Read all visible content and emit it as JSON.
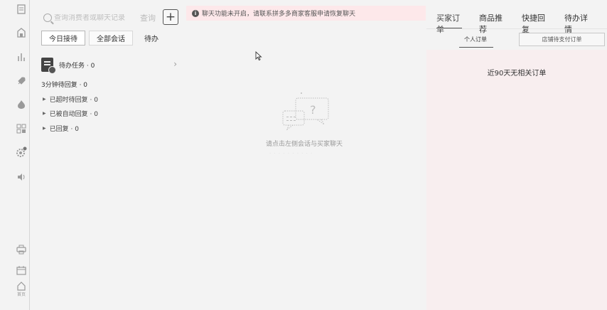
{
  "rail": {
    "icons": [
      "document-icon",
      "shop-icon",
      "bar-chart-icon",
      "rocket-icon",
      "flame-icon",
      "grid-icon",
      "gear-badge-icon",
      "speaker-icon",
      "printer-icon",
      "calendar-icon",
      "home-icon"
    ],
    "home_label": "首页"
  },
  "search": {
    "placeholder": "查询消费者或聊天记录",
    "query_label": "查询",
    "add_label": "+"
  },
  "conversation_tabs": [
    {
      "label": "今日接待",
      "active": true
    },
    {
      "label": "全部会话",
      "active": false
    },
    {
      "label": "待办",
      "active": false
    }
  ],
  "tasks": {
    "label": "待办任务 · 0",
    "arrow": "›"
  },
  "reply_section": {
    "title": "3分钟待回复 · 0",
    "items": [
      {
        "label": "已超时待回复 · 0"
      },
      {
        "label": "已被自动回复 · 0"
      },
      {
        "label": "已回复 · 0"
      }
    ]
  },
  "banner": {
    "icon": "info-icon",
    "text": "聊天功能未开启，请联系拼多多商家客服申请恢复聊天"
  },
  "empty_state": {
    "text": "请点击左侧会话与买家聊天",
    "subtext": "· · · · · · · · · ·",
    "icon": "chat-question-icon"
  },
  "right_panel": {
    "tabs": [
      {
        "label": "买家订单",
        "active": true
      },
      {
        "label": "商品推荐",
        "active": false
      },
      {
        "label": "快捷回复",
        "active": false
      },
      {
        "label": "待办详情",
        "active": false
      }
    ],
    "subtabs": {
      "personal": "个人订单",
      "store": "店铺待支付订单"
    },
    "empty_text": "近90天无相关订单"
  },
  "colors": {
    "banner_bg": "#fde8ea",
    "right_panel_bg": "#f8eeef",
    "page_bg": "#f3f3f3"
  }
}
